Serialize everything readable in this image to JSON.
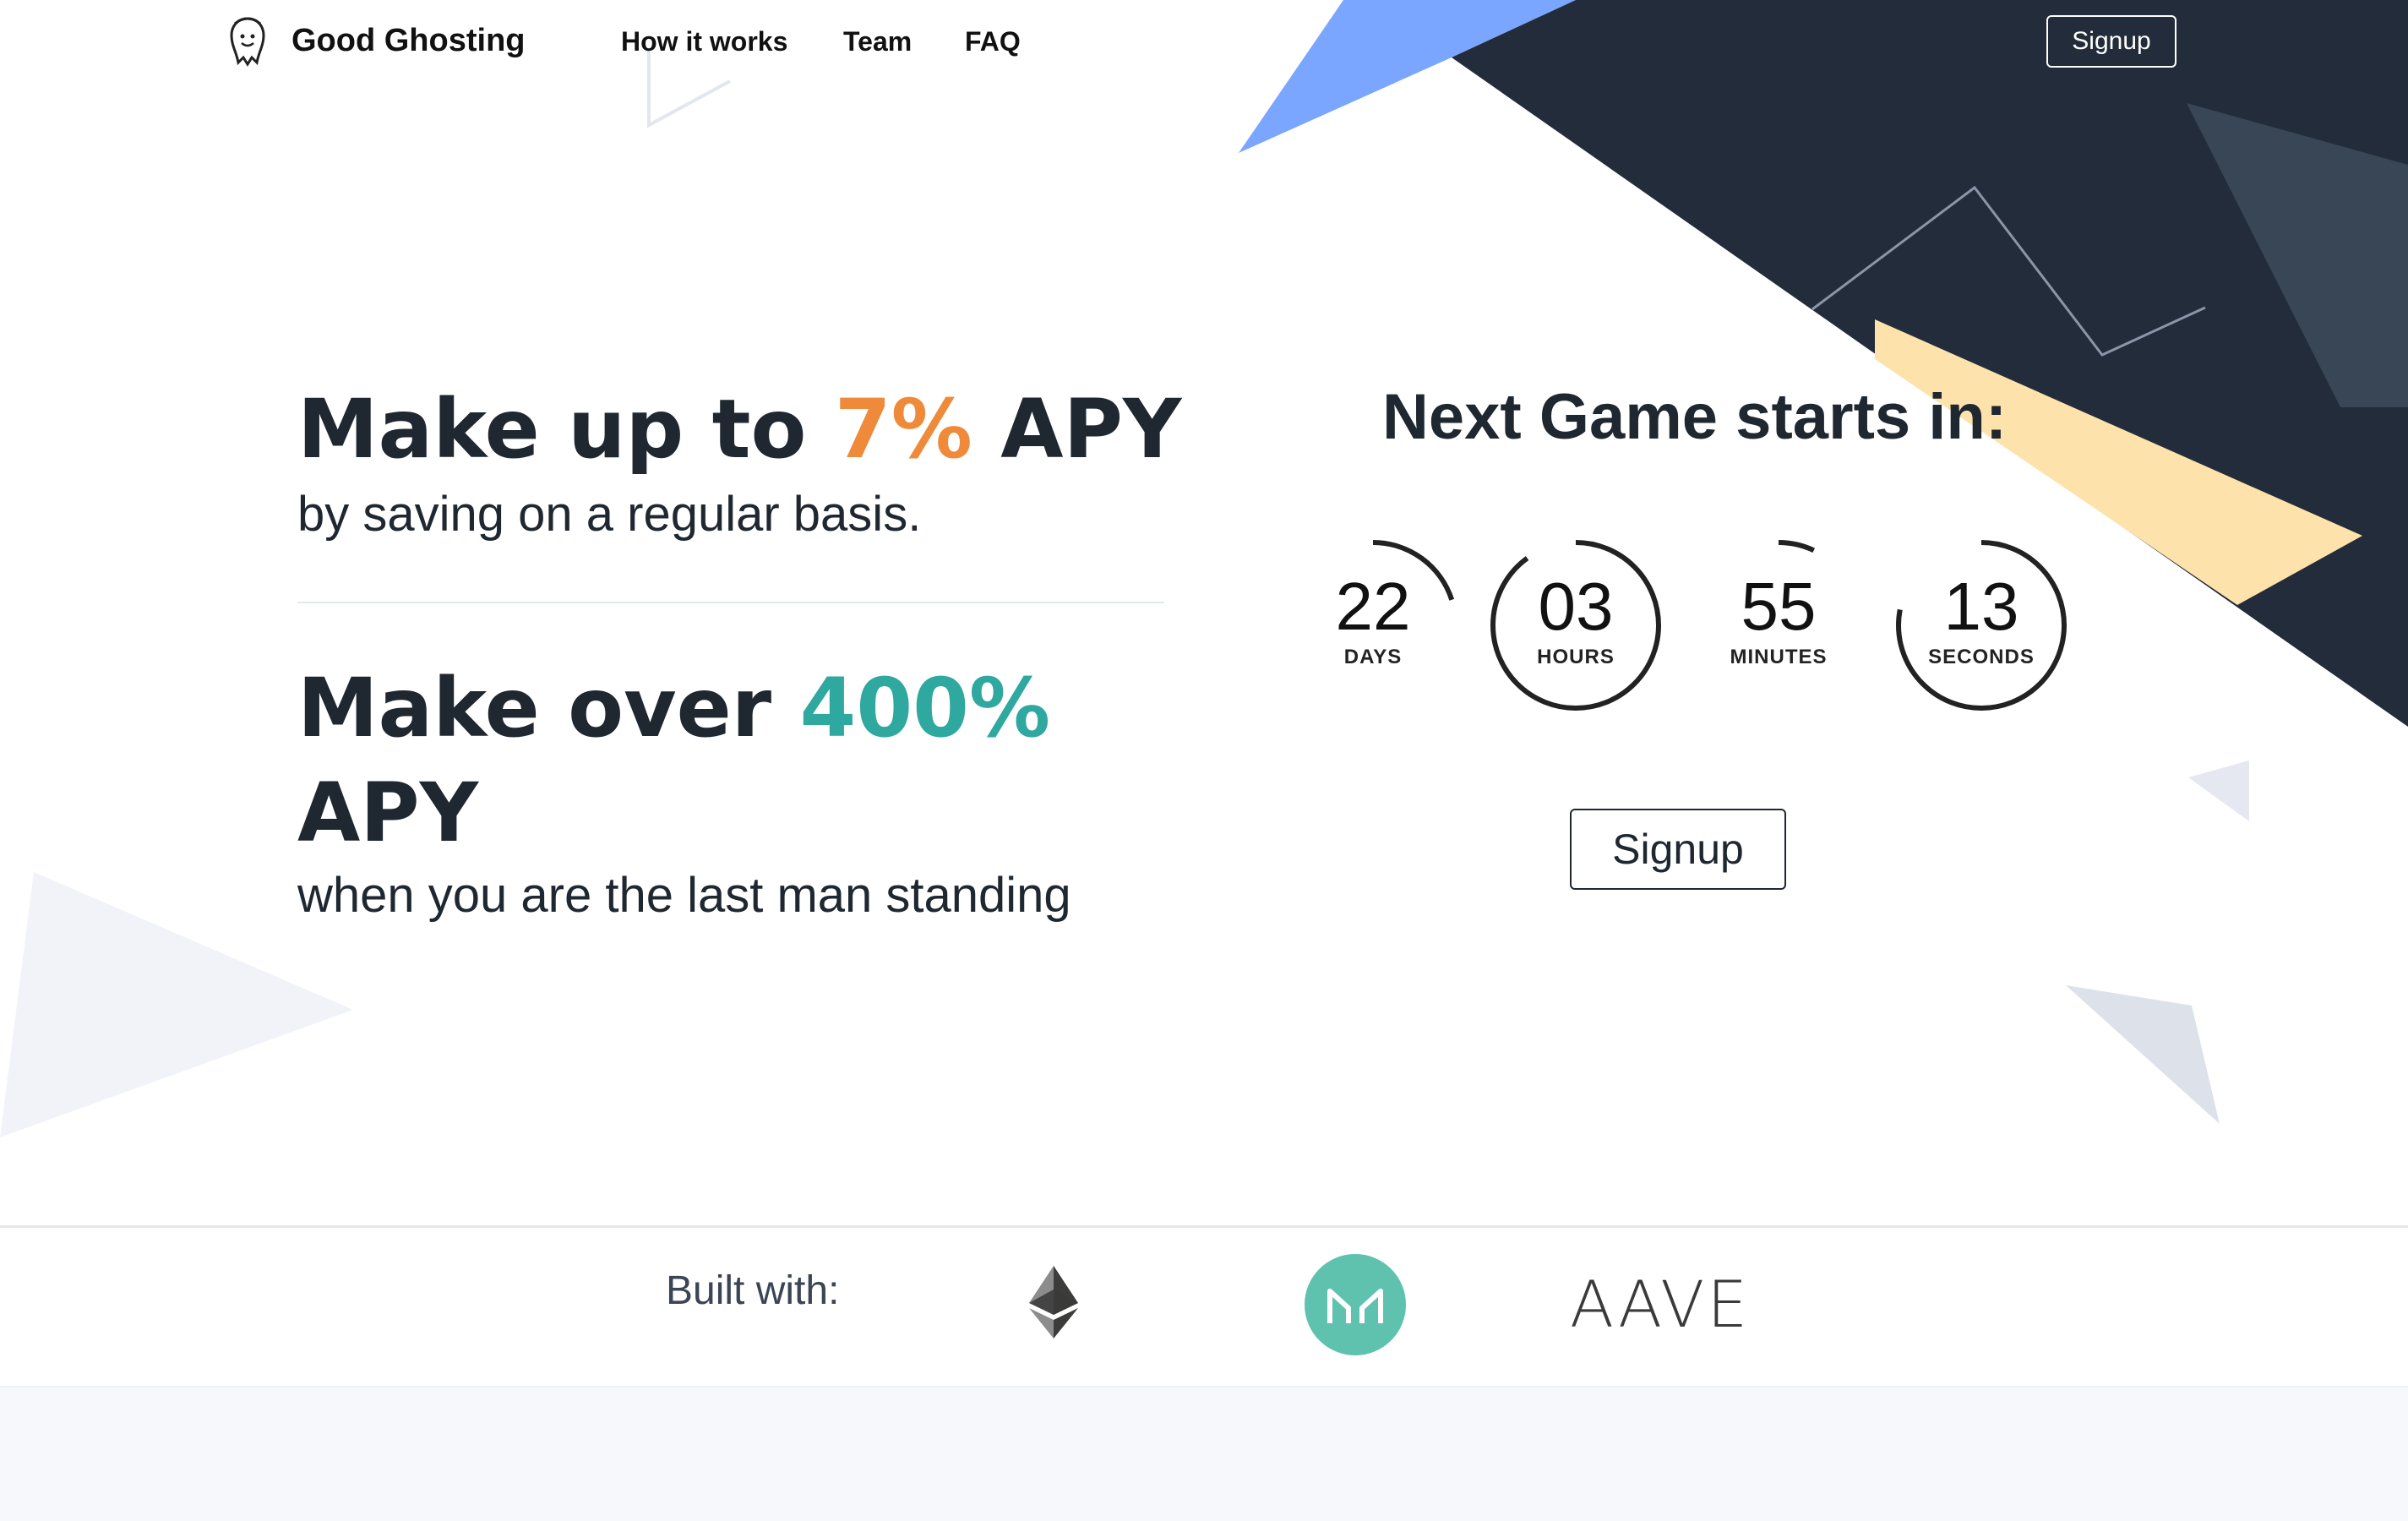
{
  "header": {
    "brand": "Good Ghosting",
    "nav": [
      {
        "label": "How it works"
      },
      {
        "label": "Team"
      },
      {
        "label": "FAQ"
      }
    ],
    "signup_label": "Signup"
  },
  "hero": {
    "line1_pre": "Make up to ",
    "line1_highlight": "7%",
    "line1_post": " APY",
    "line1_sub": "by saving on a regular basis.",
    "line2_pre": "Make over ",
    "line2_highlight": "400%",
    "line2_post": "APY",
    "line2_sub": "when you are the last man standing",
    "highlight_colors": {
      "orange": "#ee8a3a",
      "teal": "#2fa8a0"
    }
  },
  "countdown": {
    "title": "Next Game starts in:",
    "units": [
      {
        "value": "22",
        "label": "DAYS",
        "fraction": 0.2
      },
      {
        "value": "03",
        "label": "HOURS",
        "fraction": 0.9
      },
      {
        "value": "55",
        "label": "MINUTES",
        "fraction": 0.07
      },
      {
        "value": "13",
        "label": "SECONDS",
        "fraction": 0.78
      }
    ],
    "signup_label": "Signup"
  },
  "built_with": {
    "label": "Built with:",
    "logos": [
      {
        "icon": "ethereum-icon"
      },
      {
        "icon": "maker-icon"
      },
      {
        "name": "AAVE",
        "icon": "aave-logo"
      }
    ]
  },
  "colors": {
    "dark_shape": "#222c3a",
    "blue_shape": "#7aa6ff",
    "yellow_shape": "#fde2ac",
    "maker_teal": "#5fc2ae"
  }
}
